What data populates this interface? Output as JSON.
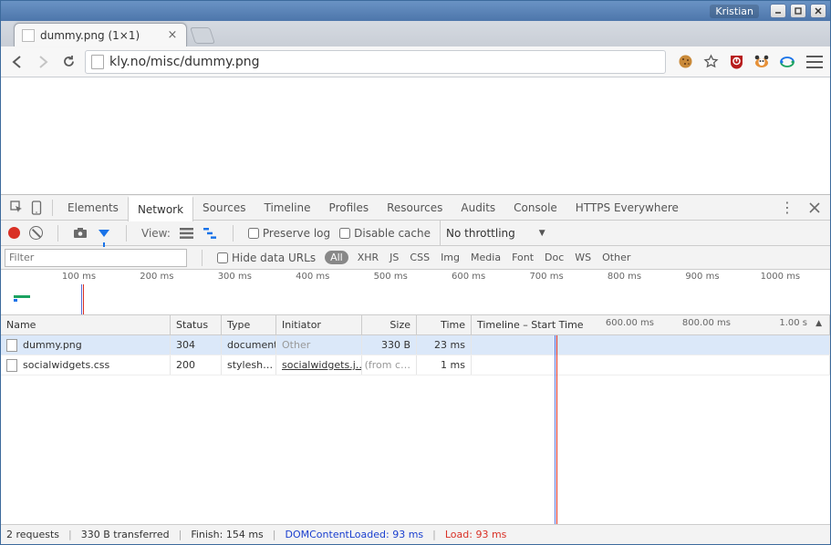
{
  "window": {
    "user": "Kristian"
  },
  "browser": {
    "tab_title": "dummy.png (1×1)",
    "url": "kly.no/misc/dummy.png"
  },
  "devtools": {
    "panels": [
      "Elements",
      "Network",
      "Sources",
      "Timeline",
      "Profiles",
      "Resources",
      "Audits",
      "Console",
      "HTTPS Everywhere"
    ],
    "active_panel": "Network",
    "toolbar": {
      "view_label": "View:",
      "preserve_log": "Preserve log",
      "disable_cache": "Disable cache",
      "throttling": "No throttling"
    },
    "filterbar": {
      "filter_placeholder": "Filter",
      "hide_data_urls": "Hide data URLs",
      "all": "All",
      "types": [
        "XHR",
        "JS",
        "CSS",
        "Img",
        "Media",
        "Font",
        "Doc",
        "WS",
        "Other"
      ]
    },
    "overview": {
      "ticks": [
        "100 ms",
        "200 ms",
        "300 ms",
        "400 ms",
        "500 ms",
        "600 ms",
        "700 ms",
        "800 ms",
        "900 ms",
        "1000 ms"
      ]
    },
    "columns": {
      "name": "Name",
      "status": "Status",
      "type": "Type",
      "initiator": "Initiator",
      "size": "Size",
      "time": "Time",
      "timeline": "Timeline – Start Time",
      "tl_ticks": [
        "600.00 ms",
        "800.00 ms",
        "1.00 s"
      ]
    },
    "requests": [
      {
        "name": "dummy.png",
        "status": "304",
        "type": "document",
        "initiator": "Other",
        "initiator_muted": true,
        "size": "330 B",
        "time": "23 ms",
        "selected": true,
        "bar": {
          "left_pct": 2,
          "width_pct": 3,
          "color": "#1ba260"
        }
      },
      {
        "name": "socialwidgets.css",
        "status": "200",
        "type": "stylesh…",
        "initiator": "socialwidgets.j…",
        "initiator_muted": false,
        "size": "(from c…",
        "time": "1 ms",
        "selected": false,
        "bar": {
          "left_pct": 17,
          "width_pct": 1,
          "color": "#1fa3e8"
        }
      }
    ],
    "status": {
      "requests": "2 requests",
      "transferred": "330 B transferred",
      "finish": "Finish: 154 ms",
      "dcl": "DOMContentLoaded: 93 ms",
      "load": "Load: 93 ms"
    }
  }
}
